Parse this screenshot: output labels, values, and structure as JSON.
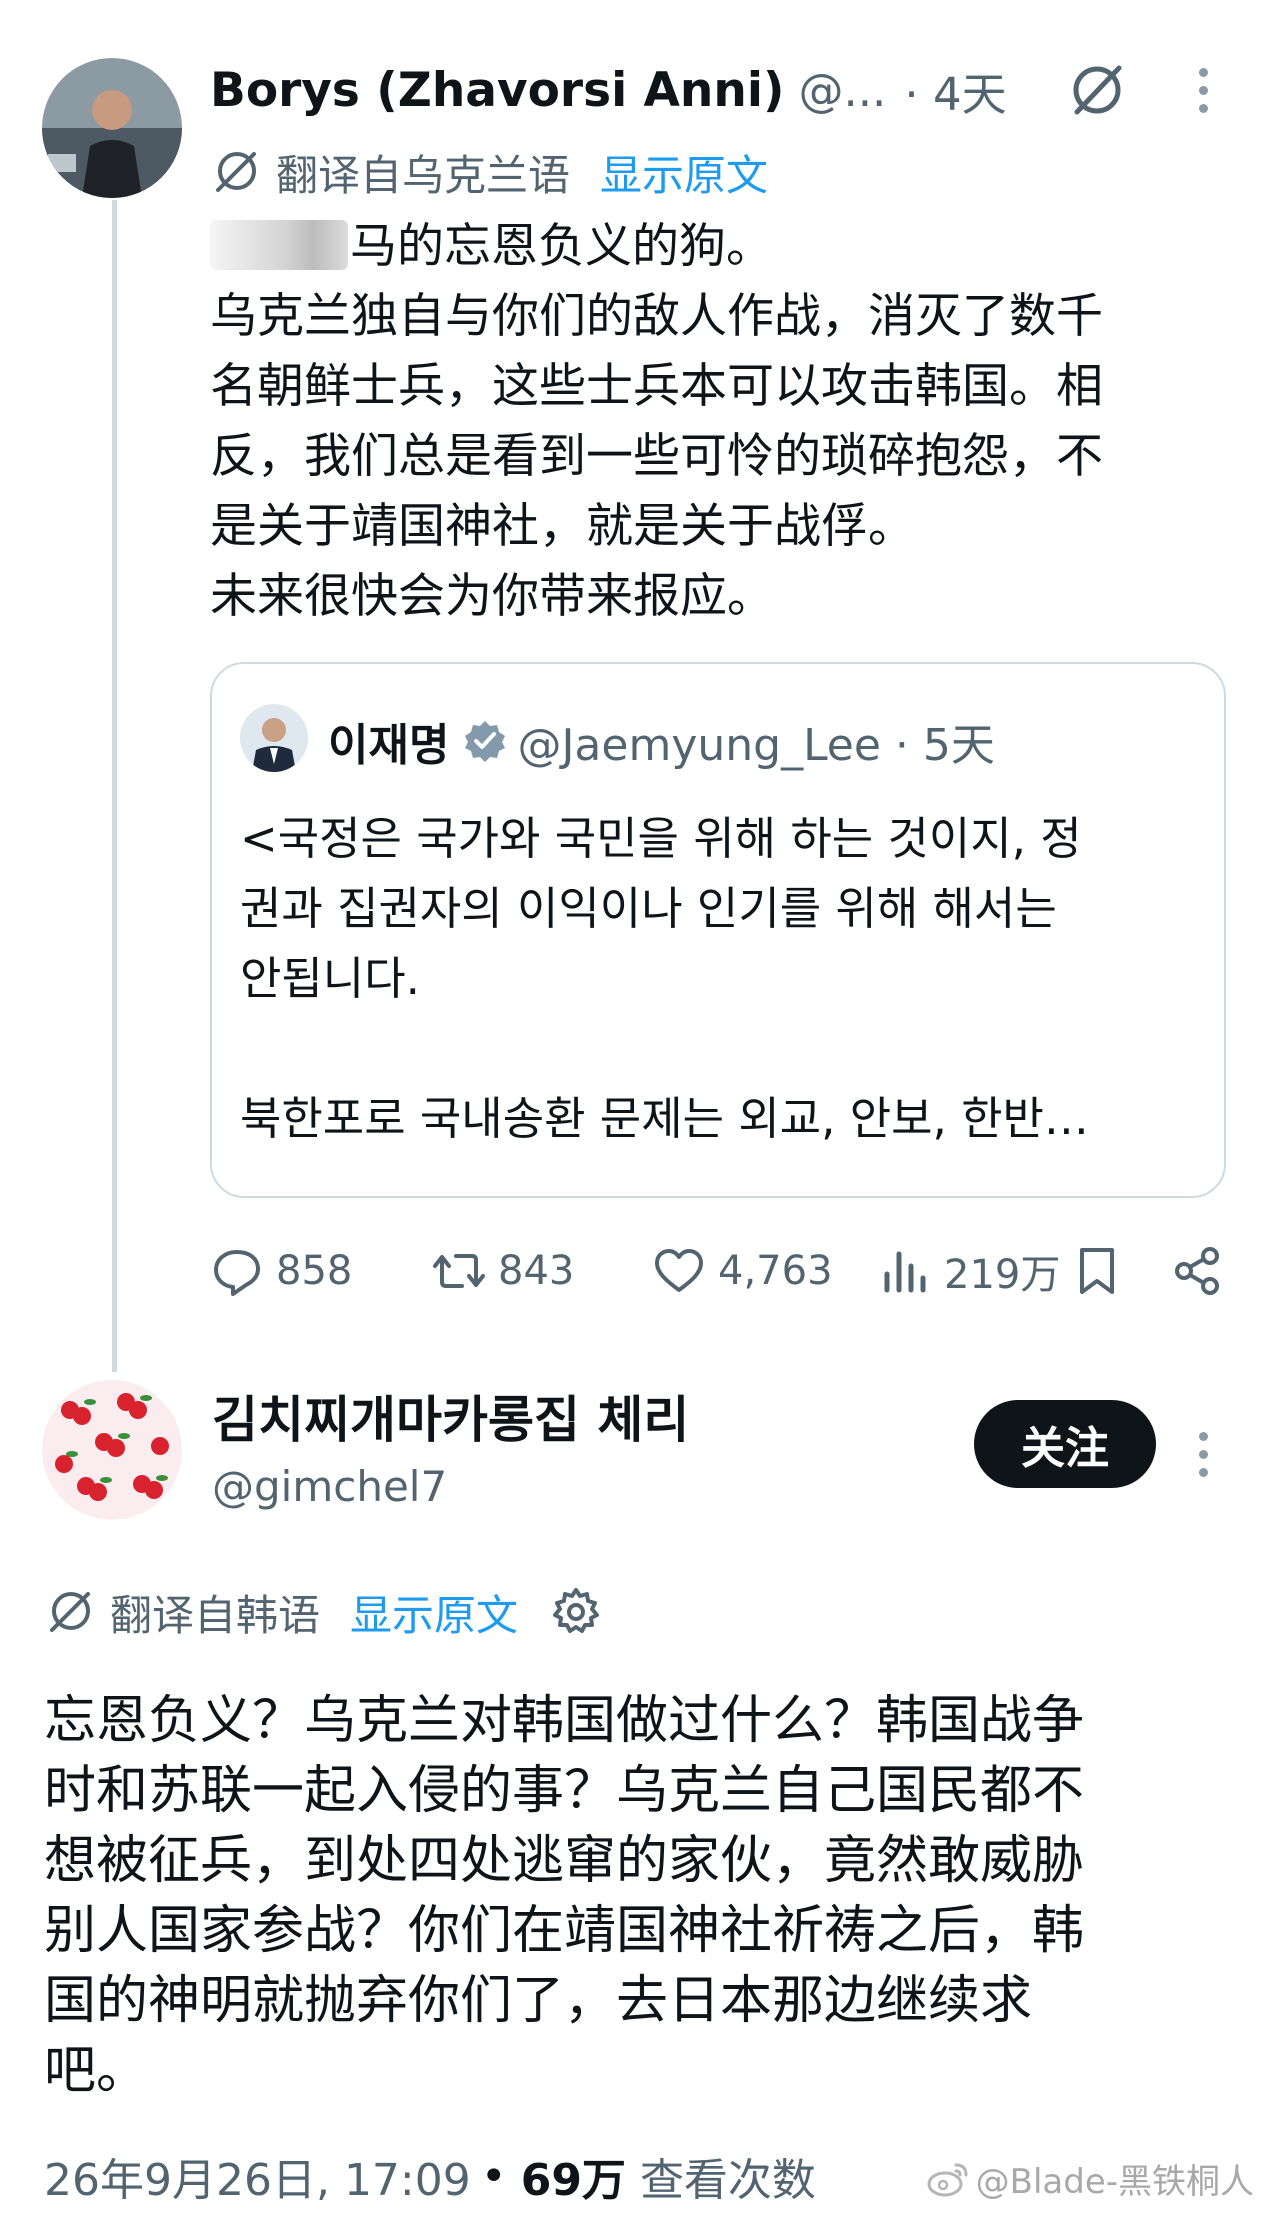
{
  "post1": {
    "author_name": "Borys (Zhavorsi Anni)",
    "handle": "@...",
    "time": "· 4天",
    "translate_label": "翻译自乌克兰语",
    "show_original": "显示原文",
    "body_lines": [
      "马的忘恩负义的狗。",
      "乌克兰独自与你们的敌人作战，消灭了数千",
      "名朝鲜士兵，这些士兵本可以攻击韩国。相",
      "反，我们总是看到一些可怜的琐碎抱怨，不",
      "是关于靖国神社，就是关于战俘。",
      "未来很快会为你带来报应。"
    ],
    "quote": {
      "author_name": "이재명",
      "handle_time": "@Jaemyung_Lee · 5天",
      "body_lines": [
        "<국정은 국가와 국민을 위해 하는 것이지, 정",
        "권과 집권자의 이익이나 인기를 위해 해서는",
        "안됩니다."
      ],
      "body_line_after_gap": "북한포로 국내송환 문제는 외교, 안보, 한반…"
    },
    "stats": {
      "replies": "858",
      "reposts": "843",
      "likes": "4,763",
      "views": "219万"
    }
  },
  "post2": {
    "author_name": "김치찌개마카롱집 체리",
    "handle": "@gimchel7",
    "follow_label": "关注",
    "translate_label": "翻译自韩语",
    "show_original": "显示原文",
    "body_lines": [
      "忘恩负义？乌克兰对韩国做过什么？韩国战争",
      "时和苏联一起入侵的事？乌克兰自己国民都不",
      "想被征兵，到处四处逃窜的家伙，竟然敢威胁",
      "别人国家参战？你们在靖国神社祈祷之后，韩",
      "国的神明就抛弃你们了，去日本那边继续求",
      "吧。"
    ],
    "timestamp": "26年9月26日, 17:09",
    "separator": "•",
    "views_count": "69万",
    "views_label": "查看次数"
  },
  "watermark": "@Blade-黑铁桐人",
  "colors": {
    "text": "#0f1419",
    "secondary": "#536471",
    "link": "#1d9bf0",
    "border": "#cfd9de",
    "follow_bg": "#0f1419"
  },
  "icons": [
    "grok-icon",
    "more-icon",
    "translate-icon",
    "verified-badge-icon",
    "reply-icon",
    "repost-icon",
    "like-icon",
    "views-icon",
    "bookmark-icon",
    "share-icon",
    "settings-gear-icon",
    "weibo-icon"
  ]
}
